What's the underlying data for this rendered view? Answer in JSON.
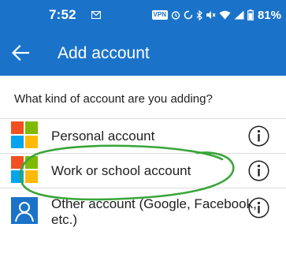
{
  "status_bar": {
    "time": "7:52",
    "vpn": "VPN",
    "battery": "81%"
  },
  "app_bar": {
    "title": "Add account"
  },
  "prompt": "What kind of account are you adding?",
  "accounts": [
    {
      "label": "Personal account"
    },
    {
      "label": "Work or school account"
    },
    {
      "label_line1": "Other account (Google, Facebook,",
      "label_line2": "etc.)"
    }
  ],
  "colors": {
    "brand_blue": "#1a73c9",
    "ms_red": "#f25022",
    "ms_green": "#7fba00",
    "ms_blue": "#00a4ef",
    "ms_yellow": "#ffb900",
    "annotation_green": "#3aa53a"
  },
  "icons": {
    "back": "arrow-left-icon",
    "info": "info-circle-icon",
    "personal": "microsoft-logo-icon",
    "work": "microsoft-logo-icon",
    "other": "person-icon"
  }
}
